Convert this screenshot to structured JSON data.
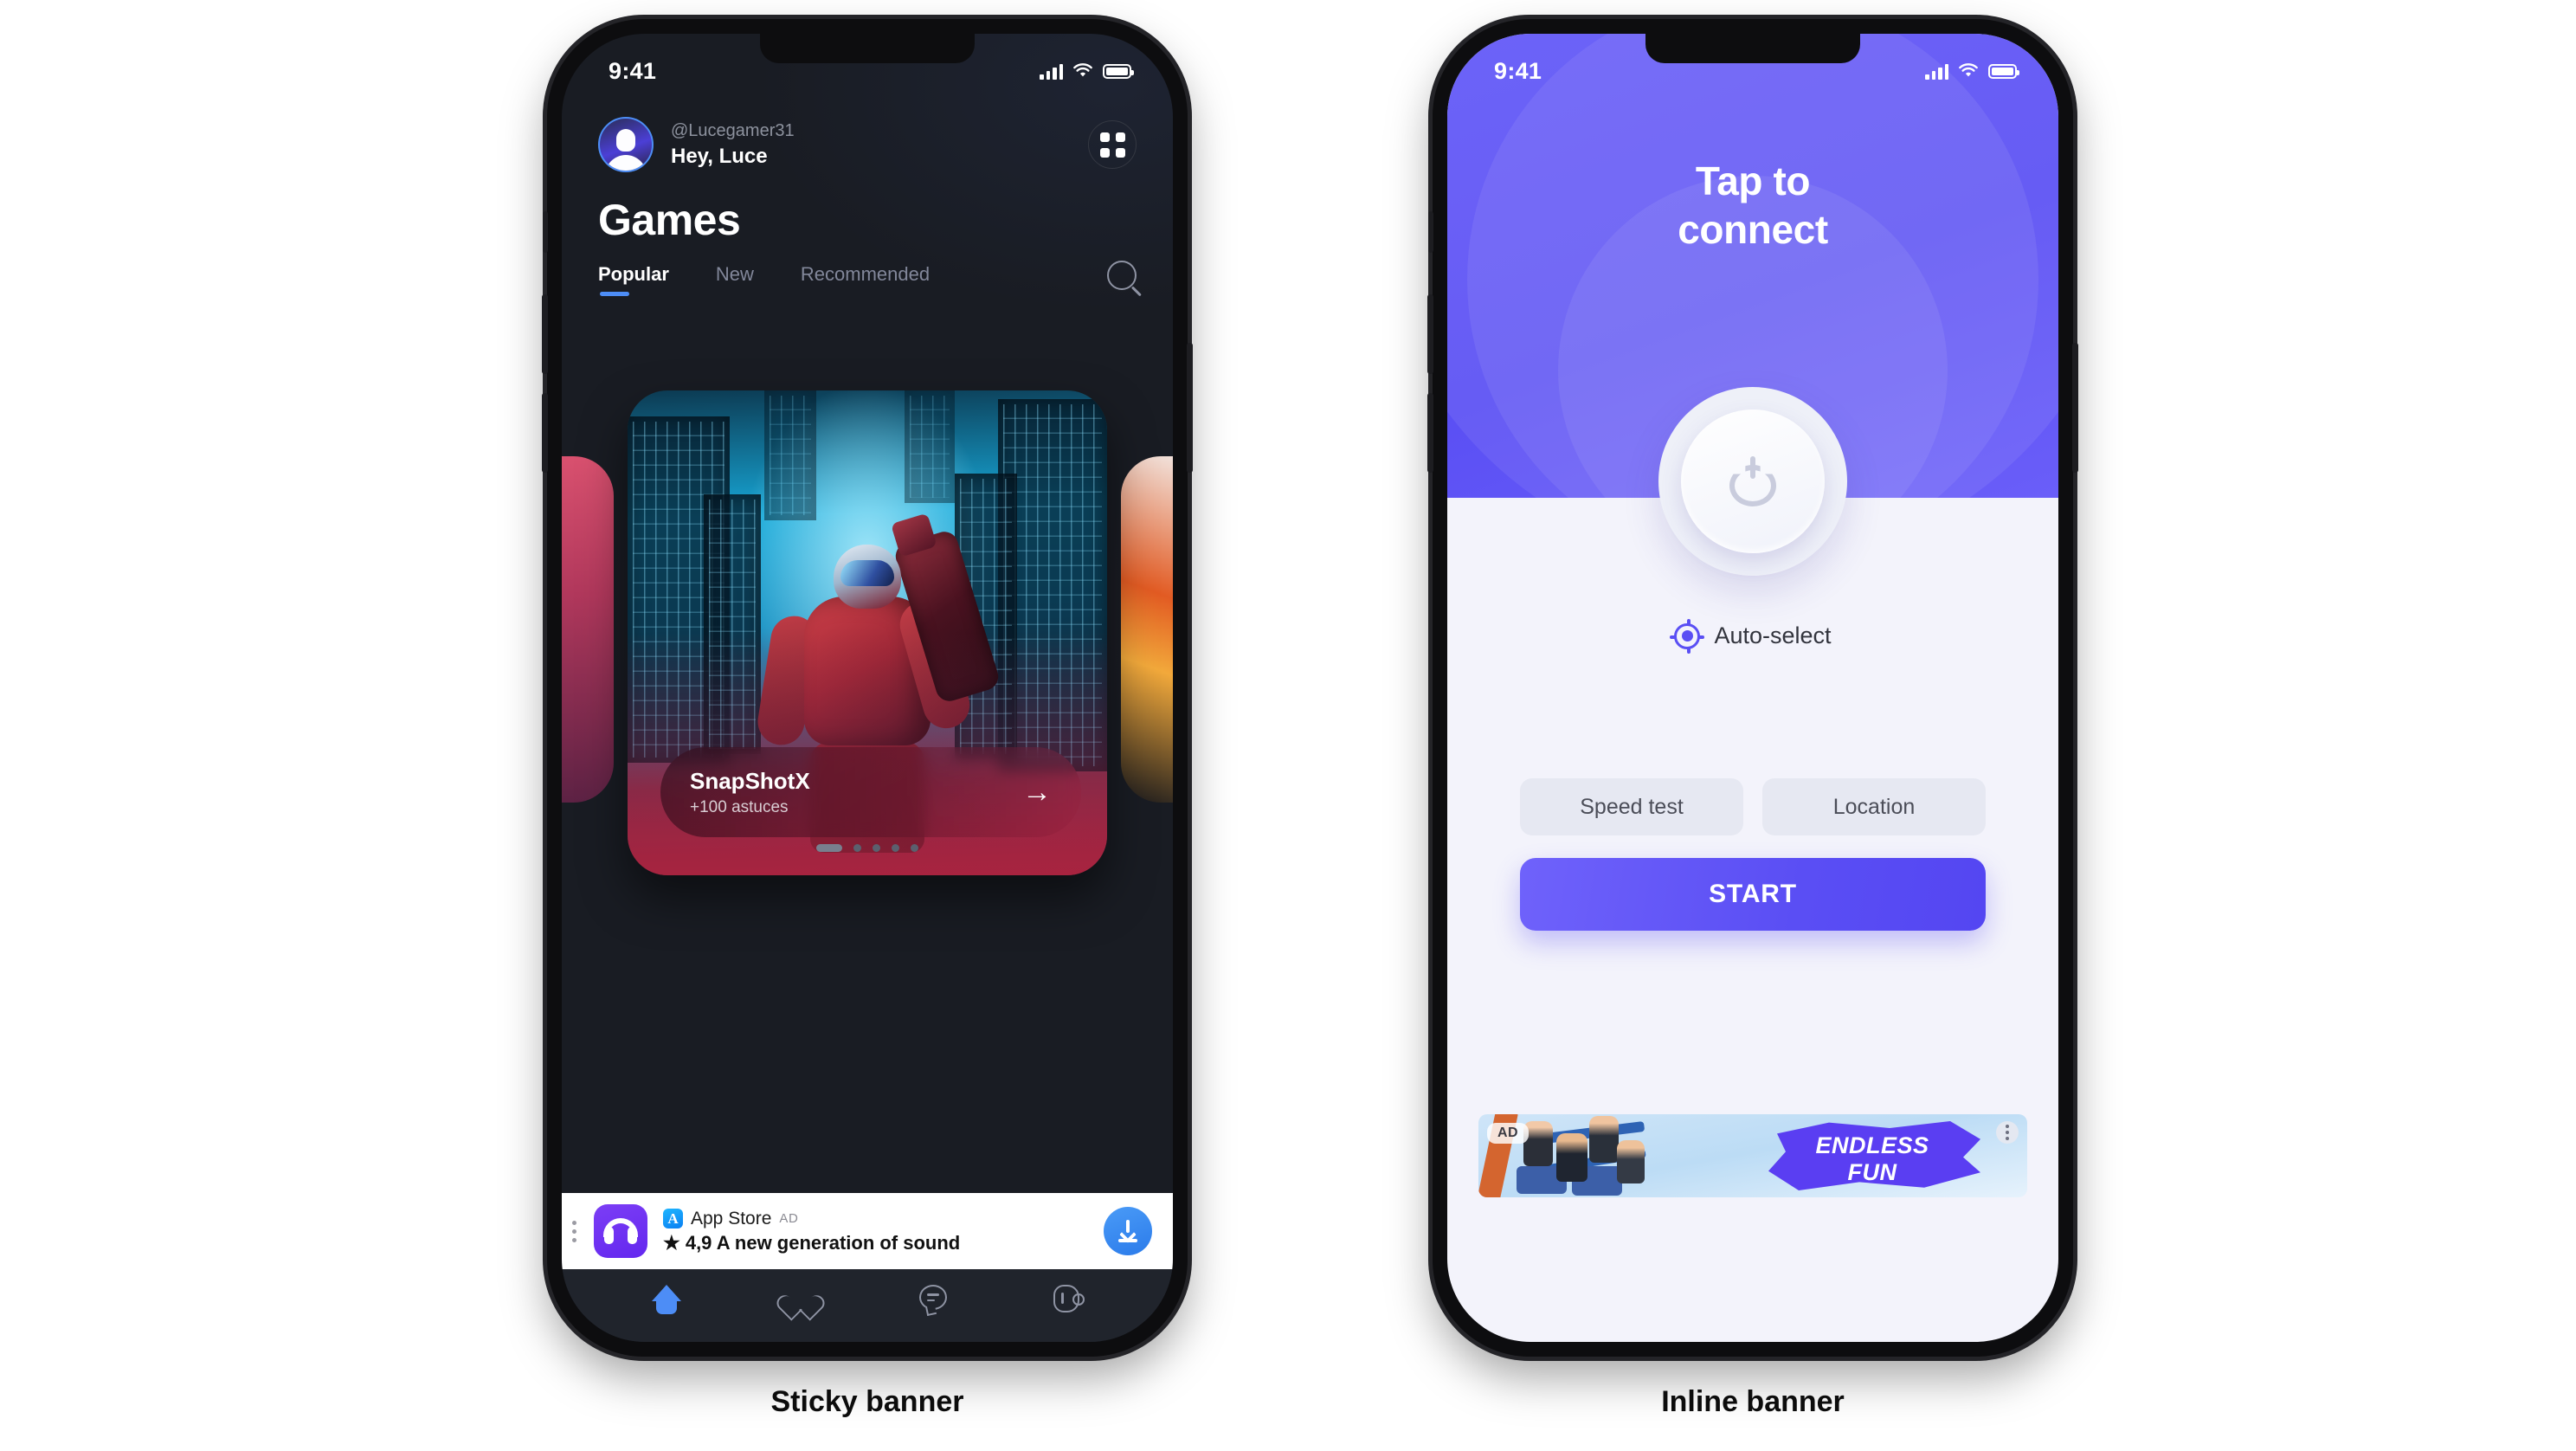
{
  "left_phone": {
    "status_bar": {
      "time": "9:41",
      "signal_icon": "cellular-signal-icon",
      "wifi_icon": "wifi-icon",
      "battery_icon": "battery-icon"
    },
    "header": {
      "avatar_icon": "avatar",
      "handle": "@Lucegamer31",
      "greeting": "Hey, Luce",
      "grid_button_icon": "grid-menu-icon"
    },
    "page_title": "Games",
    "tabs": [
      {
        "label": "Popular",
        "active": true
      },
      {
        "label": "New",
        "active": false
      },
      {
        "label": "Recommended",
        "active": false
      }
    ],
    "search_icon": "search-icon",
    "carousel": {
      "card": {
        "title": "SnapShotX",
        "subtitle": "+100 astuces",
        "arrow_icon": "arrow-right-icon"
      },
      "dots_total": 5,
      "active_dot": 1
    },
    "sticky_ad": {
      "menu_icon": "kebab-menu-vertical-icon",
      "app_icon": "headphones-icon",
      "store_icon": "app-store-icon",
      "store_name": "App Store",
      "ad_label": "AD",
      "headline": "★ 4,9 A new generation of sound",
      "download_icon": "download-icon"
    },
    "bottom_nav": [
      {
        "icon": "home-icon",
        "active": true
      },
      {
        "icon": "heart-icon",
        "active": false
      },
      {
        "icon": "chat-bubble-icon",
        "active": false
      },
      {
        "icon": "profile-icon",
        "active": false
      }
    ]
  },
  "right_phone": {
    "status_bar": {
      "time": "9:41",
      "signal_icon": "cellular-signal-icon",
      "wifi_icon": "wifi-icon",
      "battery_icon": "battery-icon"
    },
    "title": "Tap to\nconnect",
    "power_button_icon": "power-icon",
    "location_mode": {
      "icon": "target-icon",
      "label": "Auto-select"
    },
    "pills": [
      {
        "label": "Speed test"
      },
      {
        "label": "Location"
      }
    ],
    "start_button": "START",
    "inline_ad": {
      "ad_label": "AD",
      "headline_line1": "ENDLESS",
      "headline_line2": "FUN",
      "menu_icon": "kebab-menu-vertical-icon"
    }
  },
  "captions": {
    "left": "Sticky banner",
    "right": "Inline banner"
  },
  "colors": {
    "accent_blue": "#4d8df6",
    "accent_purple": "#5a4ff4",
    "dark_bg": "#191c23",
    "light_bg": "#f3f3fb"
  }
}
